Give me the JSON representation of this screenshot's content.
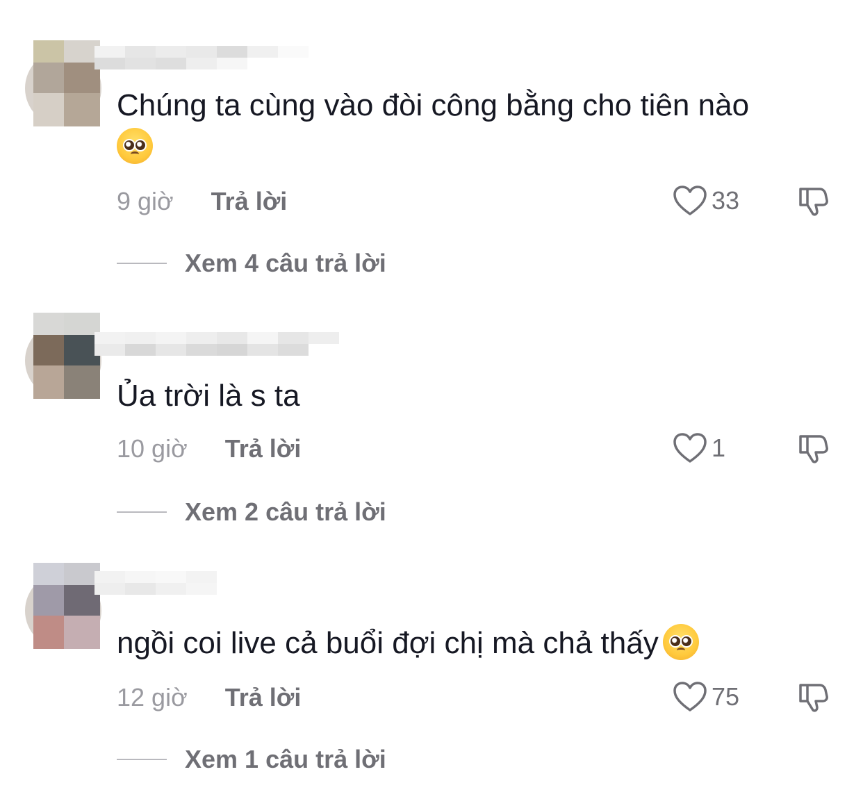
{
  "comments": [
    {
      "text": "Chúng ta cùng vào đòi công bằng cho tiên nào",
      "emoji": "pleading-face-emoji",
      "time": "9 giờ",
      "reply_label": "Trả lời",
      "likes": "33",
      "view_replies": "Xem 4 câu trả lời",
      "avatar_colors": [
        "#cbc4a6",
        "#d7d3cd",
        "#b1a69a",
        "#a08f7f",
        "#d6cfc6",
        "#b5a797"
      ]
    },
    {
      "text": "Ủa trời là s ta",
      "time": "10 giờ",
      "reply_label": "Trả lời",
      "likes": "1",
      "view_replies": "Xem 2 câu trả lời",
      "avatar_colors": [
        "#d8d8d6",
        "#d5d6d3",
        "#7c6a5a",
        "#495256",
        "#b8a697",
        "#8a8278"
      ]
    },
    {
      "text": "ngồi coi live cả buổi đợi chị mà chả thấy",
      "emoji": "pleading-face-emoji",
      "time": "12 giờ",
      "reply_label": "Trả lời",
      "likes": "75",
      "view_replies": "Xem 1 câu trả lời",
      "avatar_colors": [
        "#cfd0d8",
        "#c9c9ce",
        "#9f9aa8",
        "#6f6a74",
        "#bf8c86",
        "#c5aeb2"
      ]
    }
  ],
  "icons": {
    "like": "heart-outline-icon",
    "dislike": "thumbs-down-outline-icon"
  },
  "colors": {
    "text": "#161823",
    "secondary": "#6f6f75",
    "time": "#9a9aa0"
  }
}
